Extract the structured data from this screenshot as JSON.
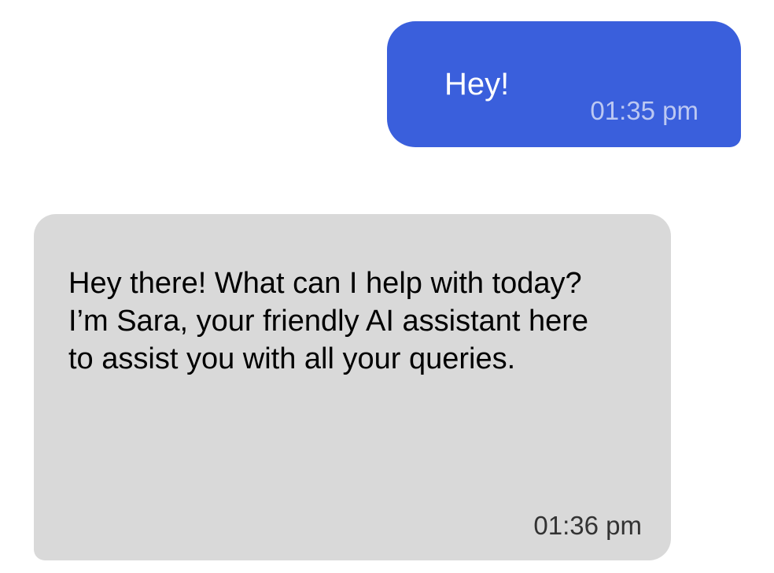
{
  "chat": {
    "messages": [
      {
        "sender": "user",
        "text": "Hey!",
        "time": "01:35 pm"
      },
      {
        "sender": "assistant",
        "text": "Hey there! What can I help with today? I’m Sara, your friendly AI assistant here to assist you with all your queries.",
        "time": "01:36 pm"
      }
    ]
  },
  "colors": {
    "sent_bubble": "#3a5fdc",
    "received_bubble": "#d9d9d9",
    "sent_text": "#ffffff",
    "sent_time": "#bcc8f2",
    "received_text": "#000000",
    "received_time": "#333333",
    "background": "#ffffff"
  }
}
